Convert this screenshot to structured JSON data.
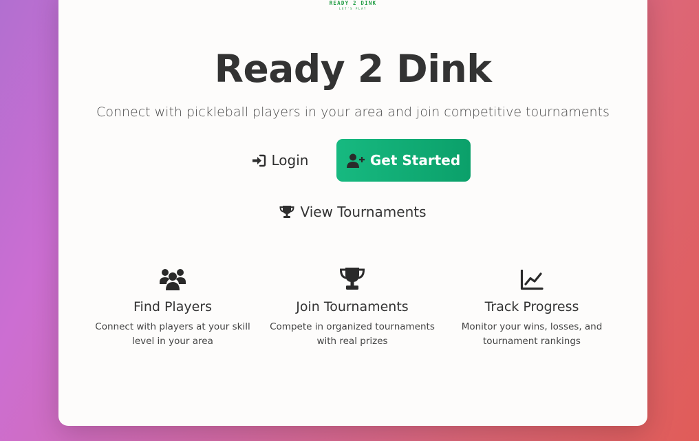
{
  "brand": {
    "logo_name": "READY 2 DINK",
    "logo_tagline": "LET'S PLAY",
    "green": "#1e9b41"
  },
  "hero": {
    "title": "Ready 2 Dink",
    "subtitle": "Connect with pickleball players in your area and join competitive tournaments"
  },
  "actions": {
    "login_label": "Login",
    "login_icon": "sign-in-icon",
    "get_started_label": "Get Started",
    "get_started_icon": "user-plus-icon",
    "view_tournaments_label": "View Tournaments",
    "view_tournaments_icon": "trophy-icon",
    "accent": "#10b07a"
  },
  "features": [
    {
      "icon": "users-icon",
      "title": "Find Players",
      "desc_line1": "Connect with players at your skill",
      "desc_line2": "level in your area"
    },
    {
      "icon": "trophy-icon",
      "title": "Join Tournaments",
      "desc_line1": "Compete in organized tournaments",
      "desc_line2": "with real prizes"
    },
    {
      "icon": "chart-line-icon",
      "title": "Track Progress",
      "desc_line1": "Monitor your wins, losses, and",
      "desc_line2": "tournament rankings"
    }
  ]
}
